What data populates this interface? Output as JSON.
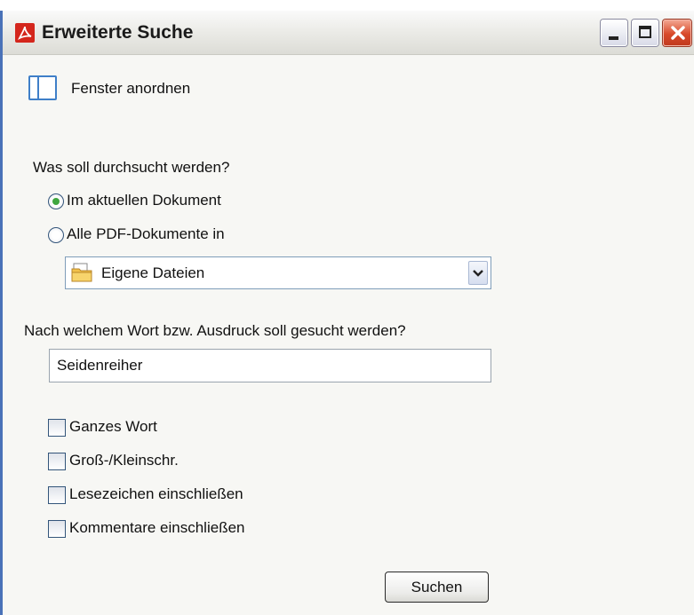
{
  "window": {
    "title": "Erweiterte Suche",
    "controls": {
      "minimize": "minimize-icon",
      "maximize": "maximize-icon",
      "close": "close-icon"
    }
  },
  "arrange": {
    "label": "Fenster anordnen",
    "icon": "window-layout-icon"
  },
  "scope": {
    "heading": "Was soll durchsucht werden?",
    "options": [
      {
        "label": "Im aktuellen Dokument",
        "checked": true
      },
      {
        "label": "Alle PDF-Dokumente in",
        "checked": false
      }
    ],
    "folder": {
      "selected": "Eigene Dateien",
      "icon": "folder-icon"
    }
  },
  "query": {
    "heading": "Nach welchem Wort bzw. Ausdruck soll gesucht werden?",
    "value": "Seidenreiher"
  },
  "options": [
    {
      "label": "Ganzes Wort",
      "checked": false
    },
    {
      "label": "Groß-/Kleinschr.",
      "checked": false
    },
    {
      "label": "Lesezeichen einschließen",
      "checked": false
    },
    {
      "label": "Kommentare einschließen",
      "checked": false
    }
  ],
  "actions": {
    "search_label": "Suchen"
  },
  "colors": {
    "accent": "#4a72b8",
    "close": "#d84a2a",
    "radio_selected": "#3fa63f",
    "app_icon": "#d4261c"
  }
}
